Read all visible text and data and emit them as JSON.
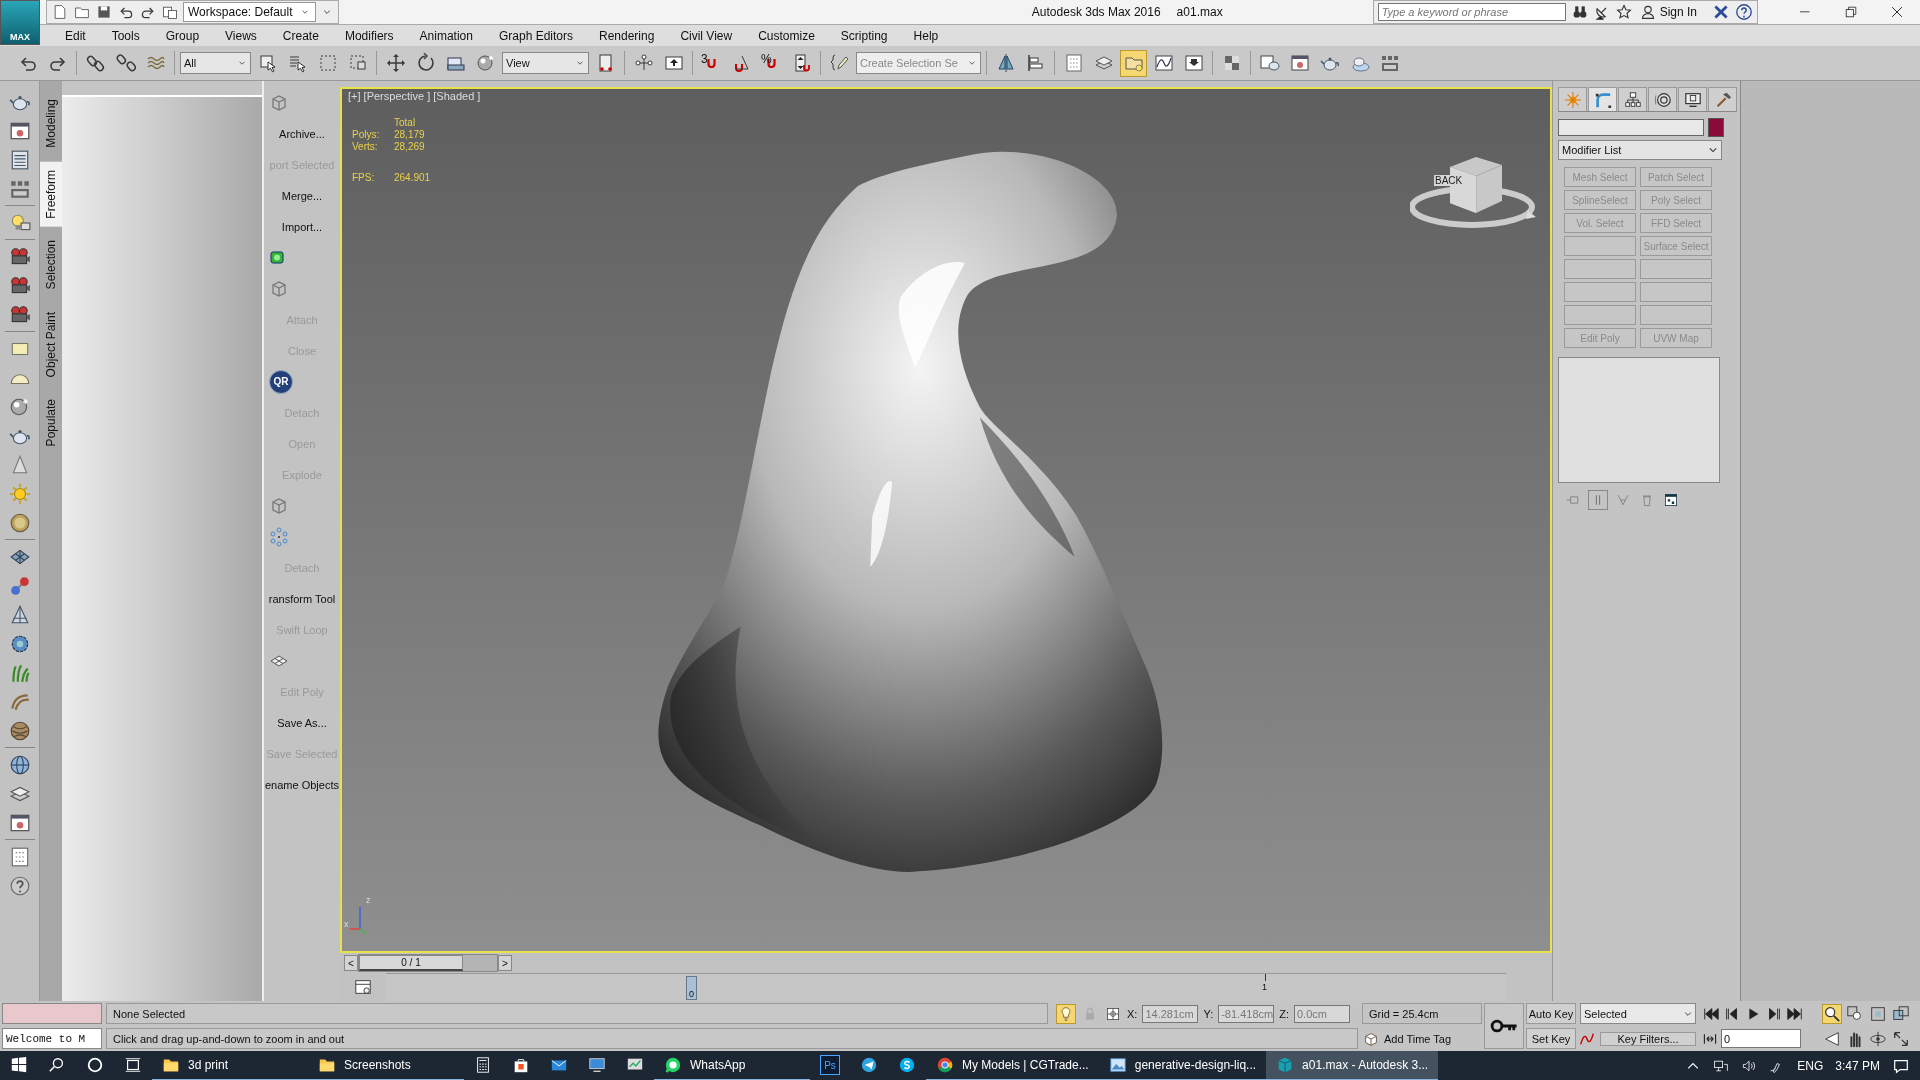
{
  "title_bar": {
    "app_button": "MAX",
    "quick_access": [
      {
        "kind": "new"
      },
      {
        "kind": "open"
      },
      {
        "kind": "save"
      },
      {
        "kind": "undo"
      },
      {
        "kind": "redo"
      },
      {
        "kind": "project"
      }
    ],
    "workspace": "Workspace: Default",
    "title": "Autodesk 3ds Max 2016",
    "file": "a01.max",
    "search": {
      "placeholder": "Type a keyword or phrase"
    },
    "info_icons": [
      {
        "kind": "binoculars"
      },
      {
        "kind": "satellite"
      },
      {
        "kind": "star"
      }
    ],
    "sign_in": "Sign In"
  },
  "menu": [
    "Edit",
    "Tools",
    "Group",
    "Views",
    "Create",
    "Modifiers",
    "Animation",
    "Graph Editors",
    "Rendering",
    "Civil View",
    "Customize",
    "Scripting",
    "Help"
  ],
  "toolbar": [
    {
      "kind": "undo",
      "selected": false
    },
    {
      "kind": "redo",
      "selected": false
    },
    {
      "kind": "separator"
    },
    {
      "kind": "link",
      "selected": false
    },
    {
      "kind": "unlink",
      "selected": false
    },
    {
      "kind": "bind",
      "selected": false
    },
    {
      "kind": "separator"
    },
    {
      "kind": "dropdown",
      "label": "All"
    },
    {
      "kind": "select",
      "selected": false
    },
    {
      "kind": "select-list",
      "selected": false
    },
    {
      "kind": "rect-region",
      "selected": false
    },
    {
      "kind": "crossing",
      "selected": false
    },
    {
      "kind": "separator"
    },
    {
      "kind": "move",
      "selected": false
    },
    {
      "kind": "rotate",
      "selected": false
    },
    {
      "kind": "scale",
      "selected": false
    },
    {
      "kind": "sphere",
      "selected": false
    },
    {
      "kind": "dropdown",
      "label": "View"
    },
    {
      "kind": "pivot",
      "selected": false
    },
    {
      "kind": "separator"
    },
    {
      "kind": "node",
      "selected": false
    },
    {
      "kind": "keyboard",
      "selected": false
    },
    {
      "kind": "separator"
    },
    {
      "kind": "snap",
      "label": "3",
      "selected": false
    },
    {
      "kind": "angle",
      "selected": false
    },
    {
      "kind": "snap",
      "label": "%",
      "selected": false
    },
    {
      "kind": "spinner",
      "selected": false
    },
    {
      "kind": "separator"
    },
    {
      "kind": "pencil",
      "selected": false
    },
    {
      "kind": "dropdown",
      "placeholder": "Create Selection Se"
    },
    {
      "kind": "separator"
    },
    {
      "kind": "mirror",
      "selected": false
    },
    {
      "kind": "align",
      "selected": false
    },
    {
      "kind": "separator"
    },
    {
      "kind": "layer-list",
      "selected": false
    },
    {
      "kind": "layers",
      "selected": false
    },
    {
      "kind": "folder-bulb",
      "selected": true
    },
    {
      "kind": "curve",
      "selected": false
    },
    {
      "kind": "schematic",
      "selected": false
    },
    {
      "kind": "separator"
    },
    {
      "kind": "checker",
      "selected": false
    },
    {
      "kind": "separator"
    },
    {
      "kind": "teapot-window",
      "selected": false
    },
    {
      "kind": "window",
      "selected": false
    },
    {
      "kind": "teapot",
      "selected": false
    },
    {
      "kind": "teapot-cloud",
      "selected": false
    },
    {
      "kind": "grid",
      "selected": false
    }
  ],
  "create_icons": [
    {
      "kind": "teapot"
    },
    {
      "kind": "window"
    },
    {
      "kind": "list"
    },
    {
      "kind": "grid"
    },
    {
      "kind": "separator"
    },
    {
      "kind": "bulb"
    },
    {
      "kind": "separator"
    },
    {
      "kind": "camera"
    },
    {
      "kind": "camera"
    },
    {
      "kind": "camera"
    },
    {
      "kind": "separator"
    },
    {
      "kind": "rect"
    },
    {
      "kind": "dome"
    },
    {
      "kind": "sphere"
    },
    {
      "kind": "teapot"
    },
    {
      "kind": "cone"
    },
    {
      "kind": "sun"
    },
    {
      "kind": "disc"
    },
    {
      "kind": "separator"
    },
    {
      "kind": "boxes"
    },
    {
      "kind": "molecule"
    },
    {
      "kind": "pyramid"
    },
    {
      "kind": "gear"
    },
    {
      "kind": "plant"
    },
    {
      "kind": "hair"
    },
    {
      "kind": "yarn"
    },
    {
      "kind": "separator"
    },
    {
      "kind": "globe"
    },
    {
      "kind": "layers"
    },
    {
      "kind": "window"
    },
    {
      "kind": "separator"
    },
    {
      "kind": "layer-list"
    },
    {
      "kind": "help"
    }
  ],
  "ribbon_tabs": [
    {
      "label": "Modeling",
      "selected": false
    },
    {
      "label": "Freeform",
      "selected": true
    },
    {
      "label": "Selection",
      "selected": false
    },
    {
      "label": "Object Paint",
      "selected": false
    },
    {
      "label": "Populate",
      "selected": false
    }
  ],
  "ribbon_panel": [
    {
      "kind": "cube"
    },
    {
      "kind": "button",
      "label": "Archive...",
      "disabled": false
    },
    {
      "kind": "button",
      "label": "port Selected",
      "disabled": true
    },
    {
      "kind": "button",
      "label": "Merge...",
      "disabled": false
    },
    {
      "kind": "button",
      "label": "Import...",
      "disabled": false
    },
    {
      "kind": "green-box"
    },
    {
      "kind": "cube"
    },
    {
      "kind": "button",
      "label": "Attach",
      "disabled": true
    },
    {
      "kind": "button",
      "label": "Close",
      "disabled": true
    },
    {
      "kind": "badge",
      "label": "QR"
    },
    {
      "kind": "button",
      "label": "Detach",
      "disabled": true
    },
    {
      "kind": "button",
      "label": "Open",
      "disabled": true
    },
    {
      "kind": "button",
      "label": "Explode",
      "disabled": true
    },
    {
      "kind": "cube"
    },
    {
      "kind": "dots"
    },
    {
      "kind": "button",
      "label": "Detach",
      "disabled": true
    },
    {
      "kind": "button",
      "label": "ransform Tool",
      "disabled": false
    },
    {
      "kind": "button",
      "label": "Swift Loop",
      "disabled": true
    },
    {
      "kind": "plane"
    },
    {
      "kind": "button",
      "label": "Edit Poly",
      "disabled": true
    },
    {
      "kind": "button",
      "label": "Save As...",
      "disabled": false
    },
    {
      "kind": "button",
      "label": "Save Selected",
      "disabled": true
    },
    {
      "kind": "button",
      "label": "ename Objects",
      "disabled": false
    }
  ],
  "viewport": {
    "label": "[+] [Perspective ] [Shaded ]",
    "stats_header": "Total",
    "stats": [
      {
        "label": "Polys:",
        "value": "28,179"
      },
      {
        "label": "Verts:",
        "value": "28,269"
      }
    ],
    "fps": {
      "label": "FPS:",
      "value": "264.901"
    },
    "viewcube": "BACK",
    "axes": [
      "z",
      "x"
    ]
  },
  "time_slider": {
    "prev": "<",
    "position": "0 / 1",
    "level": 0,
    "next": ">"
  },
  "track_bar": {
    "handle": "0",
    "tick": "1"
  },
  "command_panel": {
    "tabs": [
      {
        "kind": "create",
        "selected": false
      },
      {
        "kind": "modify",
        "selected": true
      },
      {
        "kind": "hierarchy",
        "selected": false
      },
      {
        "kind": "motion",
        "selected": false
      },
      {
        "kind": "display",
        "selected": false
      },
      {
        "kind": "utilities",
        "selected": false
      }
    ],
    "modifier_list": "Modifier List",
    "modifier_buttons": [
      {
        "kind": "button",
        "label": "Mesh Select"
      },
      {
        "kind": "button",
        "label": "Patch Select"
      },
      {
        "kind": "button",
        "label": "SplineSelect"
      },
      {
        "kind": "button",
        "label": "Poly Select"
      },
      {
        "kind": "button",
        "label": "Vol. Select"
      },
      {
        "kind": "button",
        "label": "FFD Select"
      },
      {
        "kind": "blank"
      },
      {
        "kind": "button",
        "label": "Surface Select"
      },
      {
        "kind": "blank"
      },
      {
        "kind": "blank"
      },
      {
        "kind": "blank"
      },
      {
        "kind": "blank"
      },
      {
        "kind": "blank"
      },
      {
        "kind": "blank"
      },
      {
        "kind": "button",
        "label": "Edit Poly"
      },
      {
        "kind": "button",
        "label": "UVW Map"
      }
    ],
    "stack_tools": [
      {
        "kind": "pin"
      },
      {
        "kind": "pipe",
        "selected": true
      },
      {
        "kind": "fork"
      },
      {
        "kind": "trash"
      },
      {
        "kind": "config"
      }
    ]
  },
  "status": {
    "listener_output": "Welcome to M",
    "selection": "None Selected",
    "prompt": "Click and drag up-and-down to zoom in and out",
    "isolate": {
      "on": true
    },
    "coords": [
      {
        "label": "X:",
        "value": "14.281cm"
      },
      {
        "label": "Y:",
        "value": "-81.418cm"
      },
      {
        "label": "Z:",
        "value": "0.0cm"
      }
    ],
    "grid": "Grid = 25.4cm",
    "time_tag": "Add Time Tag",
    "auto_key": "Auto Key",
    "set_key": "Set Key",
    "key_mode": "Selected",
    "key_filters": "Key Filters...",
    "frame": "0",
    "nav_tools": [
      {
        "kind": "zoom",
        "selected": true
      },
      {
        "kind": "zoom-all",
        "selected": false
      },
      {
        "kind": "extents",
        "selected": false
      },
      {
        "kind": "all-extents",
        "selected": false
      },
      {
        "kind": "fov",
        "selected": false
      },
      {
        "kind": "pan",
        "selected": false
      },
      {
        "kind": "orbit",
        "selected": false
      },
      {
        "kind": "maximize",
        "selected": false
      }
    ]
  },
  "taskbar": {
    "apps": [
      {
        "kind": "folder",
        "label": "3d print",
        "running": true,
        "selected": false
      },
      {
        "kind": "folder",
        "label": "Screenshots",
        "running": true,
        "selected": false
      },
      {
        "kind": "calculator",
        "running": false,
        "selected": false
      },
      {
        "kind": "bag",
        "running": false,
        "selected": false
      },
      {
        "kind": "mail",
        "running": false,
        "selected": false
      },
      {
        "kind": "monitor",
        "running": false,
        "selected": false
      },
      {
        "kind": "chart",
        "running": false,
        "selected": false
      },
      {
        "kind": "chat",
        "label": "WhatsApp",
        "running": true,
        "selected": false
      },
      {
        "kind": "ps",
        "badge": "Ps",
        "running": false,
        "selected": false
      },
      {
        "kind": "plane",
        "running": false,
        "selected": false
      },
      {
        "kind": "skype",
        "running": false,
        "selected": false
      },
      {
        "kind": "chrome",
        "label": "My Models | CGTrade...",
        "running": true,
        "selected": false
      },
      {
        "kind": "image",
        "label": "generative-design-liq...",
        "running": true,
        "selected": false
      },
      {
        "kind": "max",
        "label": "a01.max - Autodesk 3...",
        "running": true,
        "selected": true
      }
    ],
    "language": "ENG",
    "time": "3:47 PM"
  }
}
